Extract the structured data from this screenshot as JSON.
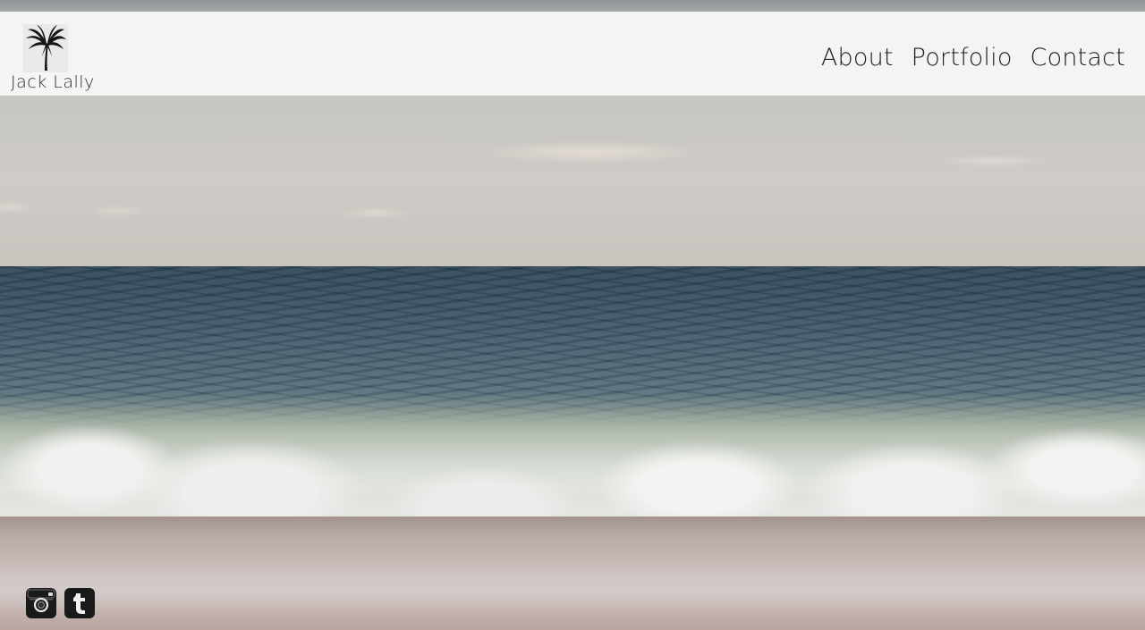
{
  "site": {
    "logo_text": "Jack Lally",
    "logo_icon": "palm-tree-icon"
  },
  "nav": {
    "items": [
      {
        "label": "About"
      },
      {
        "label": "Portfolio"
      },
      {
        "label": "Contact"
      }
    ]
  },
  "social": {
    "items": [
      {
        "icon": "instagram-icon"
      },
      {
        "icon": "tumblr-icon"
      }
    ]
  },
  "colors": {
    "header_bg": "#f7f7f6",
    "text": "#1e1e1e",
    "icon": "#1a1a1a"
  }
}
